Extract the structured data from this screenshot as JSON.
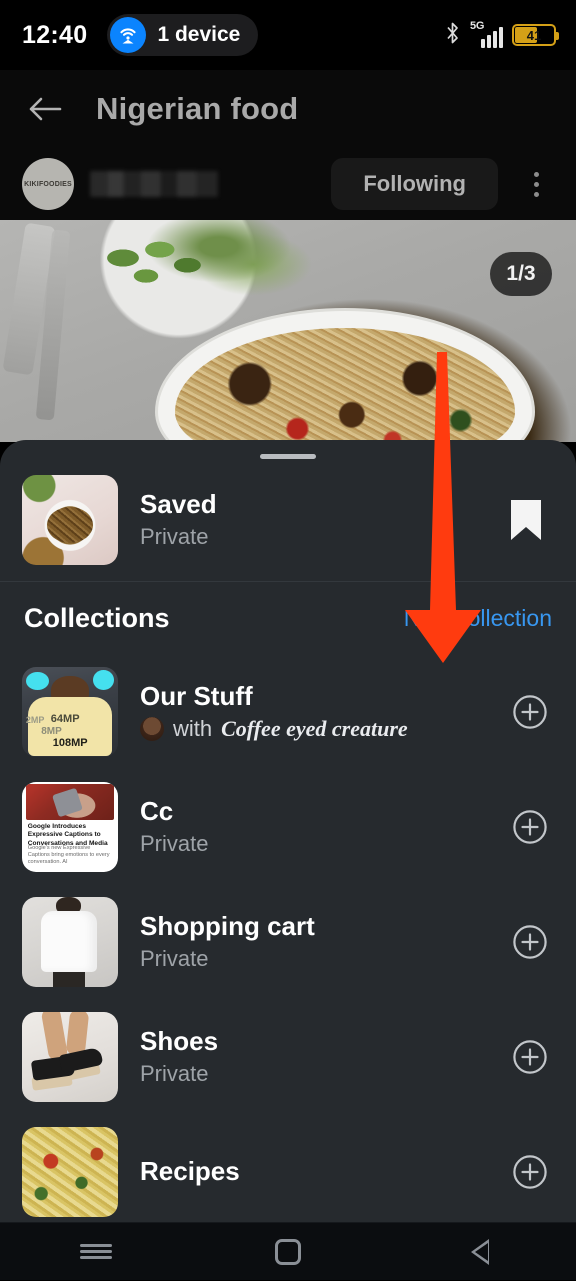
{
  "status_bar": {
    "time": "12:40",
    "hotspot_chip_label": "1 device",
    "hotspot_icon": "wifi-tethering-icon",
    "bluetooth_icon": "bluetooth-icon",
    "network_type": "5G",
    "signal_icon": "cellular-signal-icon",
    "battery_percent": "41",
    "battery_icon": "battery-icon"
  },
  "header": {
    "back_icon": "back-arrow-icon",
    "title": "Nigerian food",
    "account": {
      "avatar_text": "KIKIFOODIES",
      "username_hidden": "",
      "follow_button_label": "Following",
      "overflow_icon": "more-vertical-icon"
    }
  },
  "photo": {
    "counter": "1/3",
    "description": "Jollof rice in a white serving dish with forks and parsley"
  },
  "sheet": {
    "grabber": "drag-handle",
    "saved": {
      "title": "Saved",
      "subtitle": "Private",
      "bookmark_icon": "bookmark-filled-icon"
    },
    "collections_header": {
      "title": "Collections",
      "action_label": "New collection",
      "action_color": "#3897f0"
    },
    "collections": [
      {
        "title": "Our Stuff",
        "sub_prefix": "with ",
        "sub_name": "Coffee eyed creature",
        "collaborator_avatar": "collaborator-avatar",
        "add_icon": "plus-circle-icon",
        "thumb_labels": {
          "a": "2MP",
          "b": "64MP",
          "c": "8MP",
          "d": "108MP"
        }
      },
      {
        "title": "Cc",
        "subtitle": "Private",
        "add_icon": "plus-circle-icon",
        "thumb_headline": "Google Introduces Expressive Captions to Conversations and Media",
        "thumb_body": "Google's new Expressive Captions bring emotions to every conversation. AI"
      },
      {
        "title": "Shopping cart",
        "subtitle": "Private",
        "add_icon": "plus-circle-icon"
      },
      {
        "title": "Shoes",
        "subtitle": "Private",
        "add_icon": "plus-circle-icon"
      },
      {
        "title": "Recipes",
        "subtitle": "",
        "add_icon": "plus-circle-icon"
      }
    ]
  },
  "annotation": {
    "arrow_color": "#ff3b0f",
    "points_at": "New collection"
  },
  "navbar": {
    "recents_icon": "recents-icon",
    "home_icon": "home-icon",
    "back_icon": "back-triangle-icon"
  }
}
